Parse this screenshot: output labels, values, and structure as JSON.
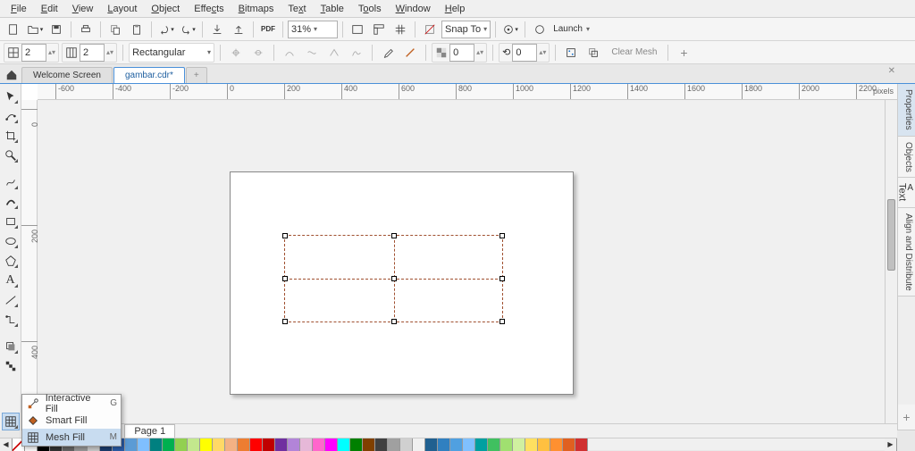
{
  "menu": {
    "file": "File",
    "edit": "Edit",
    "view": "View",
    "layout": "Layout",
    "object": "Object",
    "effects": "Effects",
    "bitmaps": "Bitmaps",
    "text": "Text",
    "table": "Table",
    "tools": "Tools",
    "window": "Window",
    "help": "Help"
  },
  "toolbar": {
    "zoom": "31%",
    "snap": "Snap To",
    "launch": "Launch",
    "spin1": "2",
    "spin2": "2"
  },
  "props": {
    "shape": "Rectangular",
    "grid": "0",
    "angle": "0",
    "clear": "Clear Mesh"
  },
  "tabs": {
    "welcome": "Welcome Screen",
    "doc": "gambar.cdr*",
    "plus": "+"
  },
  "ruler": {
    "unit": "pixels",
    "h": [
      "-600",
      "-400",
      "-200",
      "0",
      "200",
      "400",
      "600",
      "800",
      "1000",
      "1200",
      "1400",
      "1600",
      "1800",
      "2000",
      "2200"
    ],
    "v": [
      "0",
      "200",
      "400"
    ]
  },
  "status": {
    "page": "Page 1"
  },
  "panels": {
    "p1": "Properties",
    "p2": "Objects",
    "p3": "Text",
    "p4": "Align and Distribute"
  },
  "flyout": {
    "t1": "Interactive Fill",
    "s1": "G",
    "t2": "Smart Fill",
    "t3": "Mesh Fill",
    "s3": "M"
  },
  "palette": [
    "#FFFFFF",
    "#000000",
    "#333333",
    "#666666",
    "#999999",
    "#CCCCCC",
    "#1A3C6E",
    "#2A5CA8",
    "#5B9BD5",
    "#7FBFFF",
    "#008080",
    "#00B050",
    "#92D050",
    "#C3E88D",
    "#FFFF00",
    "#FFD966",
    "#F4B183",
    "#ED7D31",
    "#FF0000",
    "#C00000",
    "#7030A0",
    "#B284D8",
    "#E6B8D8",
    "#FF66CC",
    "#FF00FF",
    "#00FFFF",
    "#008000",
    "#804000",
    "#404040",
    "#A0A0A0",
    "#D0D0D0",
    "#F0F0F0",
    "#206090",
    "#3080C0",
    "#50A0E0",
    "#80C0FF",
    "#00A0A0",
    "#40C060",
    "#A0E070",
    "#D0F0A0",
    "#FFE060",
    "#FFC040",
    "#FF9030",
    "#E06020",
    "#D03030"
  ],
  "chart_data": null
}
